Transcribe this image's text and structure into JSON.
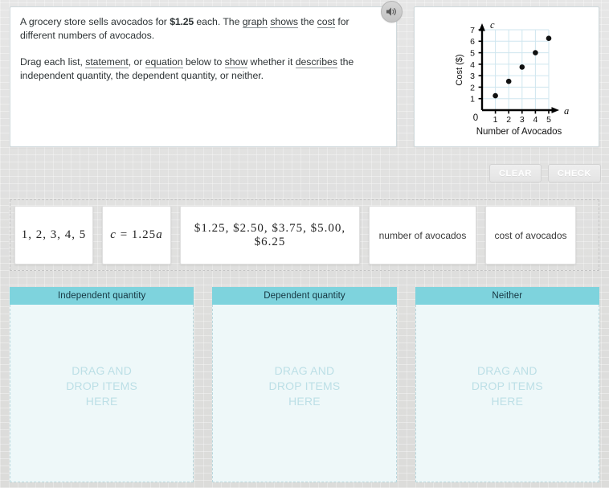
{
  "prompt": {
    "line1_a": "A grocery store sells avocados for ",
    "price": "$1.25",
    "line1_b": " each. The ",
    "vocab_graph": "graph",
    "line1_c": " ",
    "vocab_shows": "shows",
    "line1_d": " the ",
    "vocab_cost": "cost",
    "line1_e": " for different numbers of avocados.",
    "line2_a": "Drag each list, ",
    "vocab_statement": "statement",
    "line2_b": ", or ",
    "vocab_equation": "equation",
    "line2_c": " below to ",
    "vocab_show": "show",
    "line2_d": " whether it ",
    "vocab_describes": "describes",
    "line2_e": " the independent quantity, the dependent quantity, or neither."
  },
  "audio": {
    "icon": "speaker-icon",
    "label": "Read aloud"
  },
  "toolbar": {
    "clear_label": "CLEAR",
    "check_label": "CHECK"
  },
  "chart_data": {
    "type": "scatter",
    "title": "",
    "xlabel": "Number of Avocados",
    "ylabel": "Cost ($)",
    "x_axis_variable": "a",
    "y_axis_variable": "c",
    "origin_label": "0",
    "x": [
      1,
      2,
      3,
      4,
      5
    ],
    "values": [
      1.25,
      2.5,
      3.75,
      5.0,
      6.25
    ],
    "xticks": [
      1,
      2,
      3,
      4,
      5
    ],
    "yticks": [
      1,
      2,
      3,
      4,
      5,
      6,
      7
    ],
    "xlim": [
      0,
      5.5
    ],
    "ylim": [
      0,
      7.3
    ],
    "grid": true,
    "grid_color": "#cfe6ef",
    "point_color": "#111111",
    "axis_color": "#000000",
    "legend": null
  },
  "drag_items": [
    {
      "id": "list-numbers",
      "text": "1, 2, 3, 4, 5",
      "style": "math",
      "width": "card-w1"
    },
    {
      "id": "equation",
      "text": "c = 1.25a",
      "style": "math",
      "width": "card-w2"
    },
    {
      "id": "list-costs",
      "text": "$1.25, $2.50, $3.75, $5.00, $6.25",
      "style": "math",
      "width": "card-w3"
    },
    {
      "id": "stmt-number",
      "text": "number of avocados",
      "style": "plain",
      "width": "card-w4"
    },
    {
      "id": "stmt-cost",
      "text": "cost of avocados",
      "style": "plain",
      "width": "card-w5"
    }
  ],
  "drop_zones": [
    {
      "id": "independent",
      "title": "Independent quantity",
      "placeholder": "DRAG AND DROP ITEMS HERE"
    },
    {
      "id": "dependent",
      "title": "Dependent quantity",
      "placeholder": "DRAG AND DROP ITEMS HERE"
    },
    {
      "id": "neither",
      "title": "Neither",
      "placeholder": "DRAG AND DROP ITEMS HERE"
    }
  ],
  "colors": {
    "header_teal": "#7ed3dd",
    "dropzone_fill": "#eef8f9",
    "dropzone_border": "#b9d8de",
    "placeholder_text": "#bcdfe6",
    "page_bg": "#e3e3e3"
  }
}
